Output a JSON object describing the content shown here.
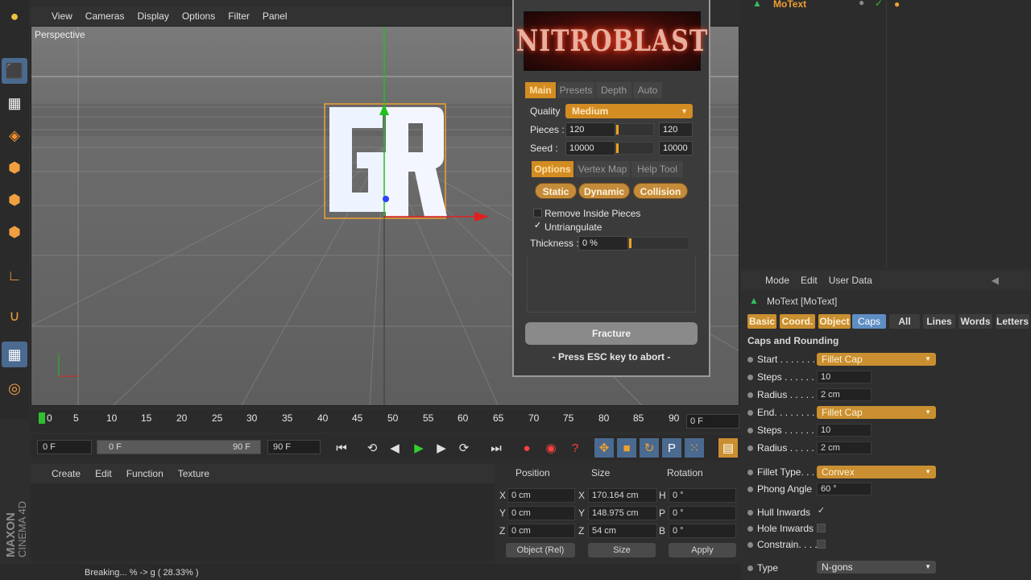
{
  "viewport": {
    "menu": [
      "View",
      "Cameras",
      "Display",
      "Options",
      "Filter",
      "Panel"
    ],
    "camera_label": "Perspective"
  },
  "timeline": {
    "ticks": [
      "0",
      "5",
      "10",
      "15",
      "20",
      "25",
      "30",
      "35",
      "40",
      "45",
      "50",
      "55",
      "60",
      "65",
      "70",
      "75",
      "80",
      "85",
      "90"
    ],
    "current_frame": "0 F",
    "start_field": "0 F",
    "range_start": "0 F",
    "range_end": "90 F",
    "end_field": "90 F"
  },
  "materials": {
    "menu": [
      "Create",
      "Edit",
      "Function",
      "Texture"
    ]
  },
  "coordinates": {
    "headers": [
      "Position",
      "Size",
      "Rotation"
    ],
    "rows": [
      {
        "axis": "X",
        "pos": "0 cm",
        "size_axis": "X",
        "size": "170.164 cm",
        "rot_axis": "H",
        "rot": "0 °"
      },
      {
        "axis": "Y",
        "pos": "0 cm",
        "size_axis": "Y",
        "size": "148.975 cm",
        "rot_axis": "P",
        "rot": "0 °"
      },
      {
        "axis": "Z",
        "pos": "0 cm",
        "size_axis": "Z",
        "size": "54 cm",
        "rot_axis": "B",
        "rot": "0 °"
      }
    ],
    "mode_select": "Object (Rel)",
    "size_select": "Size",
    "apply_label": "Apply"
  },
  "status": {
    "text": "Breaking... % -> g ( 28.33% )"
  },
  "logo": {
    "text": "MAXON CINEMA 4D"
  },
  "plugin": {
    "banner": "NITROBLAST",
    "tabs": [
      "Main",
      "Presets",
      "Depth",
      "Auto"
    ],
    "quality_label": "Quality",
    "quality_value": "Medium",
    "pieces_label": "Pieces :",
    "pieces_value": "120",
    "pieces_max": "120",
    "seed_label": "Seed :",
    "seed_value": "10000",
    "seed_max": "10000",
    "subtabs": [
      "Options",
      "Vertex Map",
      "Help Tool"
    ],
    "modes": [
      "Static",
      "Dynamic",
      "Collision"
    ],
    "remove_inside": "Remove Inside Pieces",
    "untriangulate": "Untriangulate",
    "untriangulate_checked": "✓",
    "thickness_label": "Thickness :",
    "thickness_value": "0 %",
    "fracture_label": "Fracture",
    "esc_note": "- Press ESC key to abort -"
  },
  "object_manager": {
    "object_name": "MoText"
  },
  "attributes": {
    "menu": [
      "Mode",
      "Edit",
      "User Data"
    ],
    "object_title": "MoText [MoText]",
    "tabs": [
      "Basic",
      "Coord.",
      "Object",
      "Caps",
      "All",
      "Lines",
      "Words",
      "Letters"
    ],
    "section": "Caps and Rounding",
    "rows": {
      "start_label": "Start . . . . . . .",
      "start_value": "Fillet Cap",
      "steps1_label": "Steps . . . . . .",
      "steps1_value": "10",
      "radius1_label": "Radius . . . . .",
      "radius1_value": "2 cm",
      "end_label": "End. . . . . . . .",
      "end_value": "Fillet Cap",
      "steps2_label": "Steps . . . . . .",
      "steps2_value": "10",
      "radius2_label": "Radius . . . . .",
      "radius2_value": "2 cm",
      "fillet_type_label": "Fillet Type. . .",
      "fillet_type_value": "Convex",
      "phong_label": "Phong Angle",
      "phong_value": "60 °",
      "hull_label": "Hull Inwards",
      "hull_checked": "✓",
      "hole_label": "Hole Inwards",
      "constrain_label": "Constrain. . . .",
      "type_label": "Type",
      "type_value": "N-gons"
    }
  },
  "colors": {
    "accent_orange": "#d38c22",
    "selected_blue": "#5e8ec4",
    "axis_red": "#e02020",
    "axis_green": "#20c020",
    "axis_blue": "#3040ff"
  }
}
